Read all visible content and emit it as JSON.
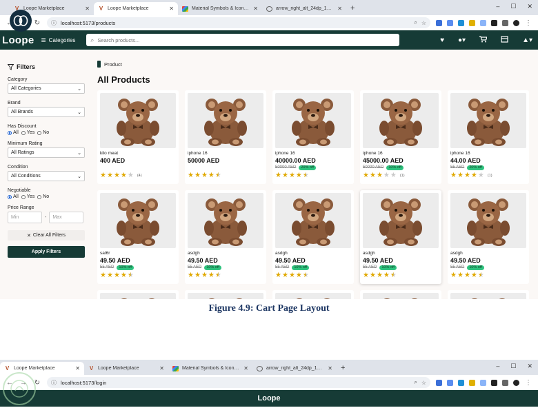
{
  "browser_top": {
    "tabs": [
      {
        "label": "Loope Marketplace",
        "icon": "v-icon",
        "active": false
      },
      {
        "label": "Loope Marketplace",
        "icon": "v-icon",
        "active": true
      },
      {
        "label": "Material Symbols & Icons - Goo...",
        "icon": "material-icon",
        "active": false
      },
      {
        "label": "arrow_right_alt_24dp_1F403C_...",
        "icon": "globe-icon",
        "active": false
      }
    ],
    "url": "localhost:5173/products"
  },
  "navbar": {
    "brand": "Loope",
    "categories_label": "Categories",
    "search_placeholder": "Search products..."
  },
  "filters": {
    "title": "Filters",
    "category_label": "Category",
    "category_value": "All Categories",
    "brand_label": "Brand",
    "brand_value": "All Brands",
    "discount_label": "Has Discount",
    "discount_options": [
      "All",
      "Yes",
      "No"
    ],
    "rating_label": "Minimum Rating",
    "rating_value": "All Ratings",
    "condition_label": "Condition",
    "condition_value": "All Conditions",
    "negotiable_label": "Negotiable",
    "negotiable_options": [
      "All",
      "Yes",
      "No"
    ],
    "price_label": "Price Range",
    "min_placeholder": "Min",
    "max_placeholder": "Max",
    "price_separator": "-",
    "clear_label": "Clear All Filters",
    "apply_label": "Apply Filters"
  },
  "main": {
    "breadcrumb": "Product",
    "title": "All Products",
    "products": [
      {
        "name": "kilo meat",
        "price": "400 AED",
        "old_price": "",
        "badge": "",
        "rating": 4,
        "count": "(4)"
      },
      {
        "name": "iphone 16",
        "price": "50000 AED",
        "old_price": "",
        "badge": "",
        "rating": 4.5,
        "count": ""
      },
      {
        "name": "iphone 16",
        "price": "40000.00 AED",
        "old_price": "50000 AED",
        "badge": "20% off",
        "rating": 4.5,
        "count": ""
      },
      {
        "name": "iphone 16",
        "price": "45000.00 AED",
        "old_price": "50000 AED",
        "badge": "10% off",
        "rating": 3,
        "count": "(1)"
      },
      {
        "name": "iphone 16",
        "price": "44.00 AED",
        "old_price": "55 AED",
        "badge": "20% off",
        "rating": 4,
        "count": "(1)"
      },
      {
        "name": "sat6r",
        "price": "49.50 AED",
        "old_price": "55 AED",
        "badge": "10% off",
        "rating": 4.5,
        "count": ""
      },
      {
        "name": "asdgh",
        "price": "49.50 AED",
        "old_price": "55 AED",
        "badge": "10% off",
        "rating": 4.5,
        "count": ""
      },
      {
        "name": "asdgh",
        "price": "49.50 AED",
        "old_price": "55 AED",
        "badge": "10% off",
        "rating": 4.5,
        "count": ""
      },
      {
        "name": "asdgh",
        "price": "49.50 AED",
        "old_price": "55 AED",
        "badge": "10% off",
        "rating": 4.5,
        "count": ""
      },
      {
        "name": "asdgh",
        "price": "49.50 AED",
        "old_price": "55 AED",
        "badge": "10% off",
        "rating": 4.5,
        "count": ""
      }
    ]
  },
  "caption": "Figure 4.9: Cart Page Layout",
  "browser_bottom": {
    "tabs": [
      {
        "label": "Loope Marketplace",
        "active": true
      },
      {
        "label": "Loope Marketplace",
        "active": false
      },
      {
        "label": "Material Symbols & Icons - Goo...",
        "active": false
      },
      {
        "label": "arrow_right_alt_24dp_1F403C_...",
        "active": false
      }
    ],
    "url": "localhost:5173/login",
    "brand": "Loope"
  },
  "colors": {
    "brand_green": "#163b36",
    "star": "#e0a800",
    "badge": "#2ec27e",
    "caption": "#1f3864"
  }
}
